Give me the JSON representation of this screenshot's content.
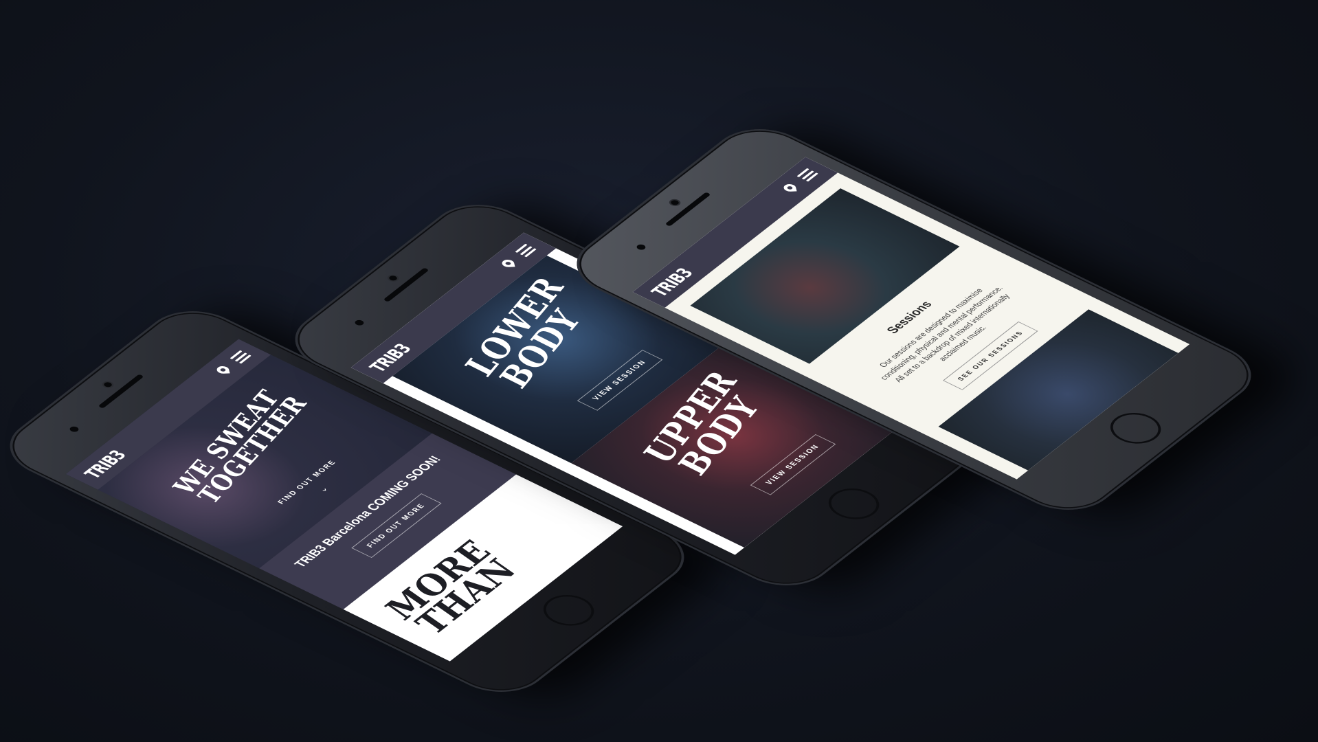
{
  "phone_home": {
    "logo": "TRIB3",
    "hero_title": "We Sweat Together",
    "hero_cta": "FIND OUT MORE",
    "promo_title": "TRIB3 Barcelona COMING SOON!",
    "promo_cta": "FIND OUT MORE",
    "section_heading": "More Than"
  },
  "phone_sessions_list": {
    "logo": "TRIB3",
    "cards": [
      {
        "title": "Lower Body",
        "cta": "VIEW SESSION"
      },
      {
        "title": "Upper Body",
        "cta": "VIEW SESSION"
      }
    ]
  },
  "phone_sessions_page": {
    "logo": "TRIB3",
    "title": "Sessions",
    "description": "Our sessions are designed to maximise conditioning, physical and mental performance. All set to a backdrop of mixed internationally acclaimed music.",
    "cta": "SEE OUR SESSIONS"
  },
  "colors": {
    "navbar": "#3b3a4d",
    "page_bg": "#10141d",
    "sessions_bg": "#f6f5ee"
  }
}
